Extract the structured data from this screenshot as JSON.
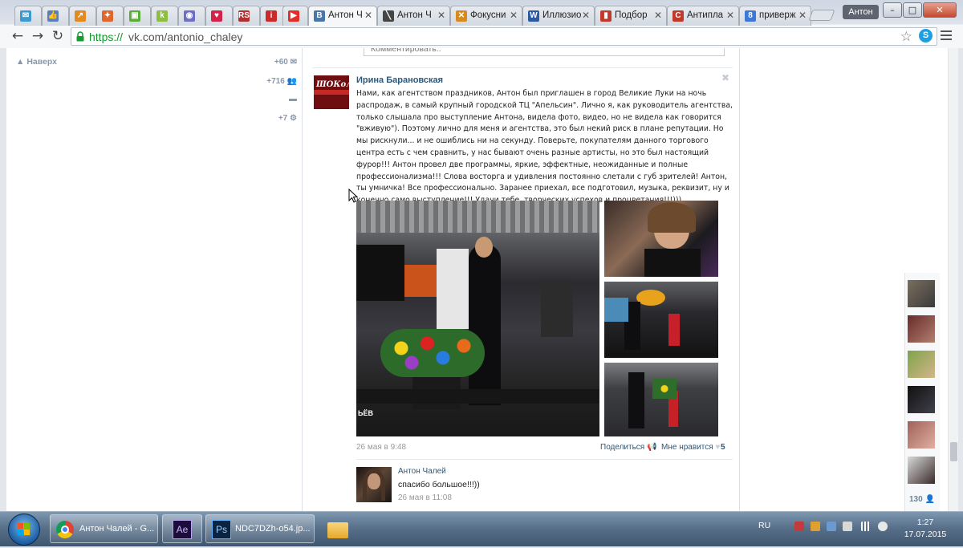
{
  "browser": {
    "tabs": [
      {
        "title": "",
        "color": "#3b9bd0",
        "glyph": "✉"
      },
      {
        "title": "",
        "color": "#5a7fb8",
        "glyph": "👍"
      },
      {
        "title": "",
        "color": "#e58a1e",
        "glyph": "↗"
      },
      {
        "title": "",
        "color": "#e0662c",
        "glyph": "✦"
      },
      {
        "title": "",
        "color": "#5caa3a",
        "glyph": "▣"
      },
      {
        "title": "",
        "color": "#8cbf3f",
        "glyph": "k"
      },
      {
        "title": "",
        "color": "#6c6fc4",
        "glyph": "◉"
      },
      {
        "title": "",
        "color": "#d3234a",
        "glyph": "♥"
      },
      {
        "title": "",
        "color": "#b03030",
        "glyph": "RS"
      },
      {
        "title": "",
        "color": "#cc2a2a",
        "glyph": "i"
      },
      {
        "title": "",
        "color": "#e52d27",
        "glyph": "▶"
      },
      {
        "title": "Антон Ч",
        "color": "#4a76a8",
        "glyph": "В"
      },
      {
        "title": "Антон Ч",
        "color": "#444444",
        "glyph": "╲"
      },
      {
        "title": "Фокусни",
        "color": "#d88b1c",
        "glyph": "✕"
      },
      {
        "title": "Иллюзио",
        "color": "#2c5aa0",
        "glyph": "W"
      },
      {
        "title": "Подбор",
        "color": "#c0392b",
        "glyph": "▮"
      },
      {
        "title": "Антипла",
        "color": "#c0392b",
        "glyph": "C"
      },
      {
        "title": "приверж",
        "color": "#3c78d8",
        "glyph": "8"
      }
    ],
    "active_tab_index": 11,
    "user_name": "Антон",
    "url_scheme": "https://",
    "url_rest": "vk.com/antonio_chaley"
  },
  "left": {
    "up_label": "Наверх",
    "counters": [
      {
        "value": "+60",
        "icon": "mail-icon"
      },
      {
        "value": "+716",
        "icon": "friends-icon"
      },
      {
        "value": "",
        "icon": "comment-icon"
      },
      {
        "value": "+7",
        "icon": "gear-icon"
      }
    ]
  },
  "post": {
    "comment_placeholder": "Комментировать..",
    "avatar_logo": "ШОКолад",
    "author": "Ирина Барановская",
    "text": "Нами, как агентством праздников, Антон был приглашен в город Великие Луки на ночь распродаж, в самый крупный городской ТЦ \"Апельсин\". Лично я, как руководитель агентства, только слышала про выступление Антона, видела фото, видео, но не видела как говорится \"вживую\"). Поэтому лично для меня и агентства, это был некий риск в плане репутации. Но мы рискнули... и не ошиблись ни на секунду. Поверьте, покупателям данного торгового центра есть с чем сравнить, у нас бывают очень разные артисты, но это был настоящий фурор!!! Антон провел две программы, яркие, эффектные, неожиданные и полные профессионализма!!! Слова восторга и удивления постоянно слетали с губ зрителей! Антон, ты умничка! Все профессионально. Заранее приехал, все подготовил, музыка, реквизит, ну и конечно само выступление!!! Удачи тебе, творческих успехов и процветания!!!)))",
    "time": "26 мая в 9:48",
    "share": "Поделиться",
    "like": "Мне нравится",
    "like_count": "5",
    "photo_caption": "ЬЁВ"
  },
  "reply": {
    "name": "Антон Чалей",
    "text": "спасибо большое!!!))",
    "time": "26 мая в 11:08"
  },
  "friends_count": "130",
  "taskbar": {
    "items": [
      {
        "label": "Антон Чалей - G...",
        "icon": "chrome-icon"
      },
      {
        "label": "",
        "icon": "after-effects-icon"
      },
      {
        "label": "NDC7DZh-o54.jp...",
        "icon": "photoshop-icon"
      },
      {
        "label": "",
        "icon": "explorer-icon"
      }
    ],
    "lang": "RU",
    "time": "1:27",
    "date": "17.07.2015"
  }
}
